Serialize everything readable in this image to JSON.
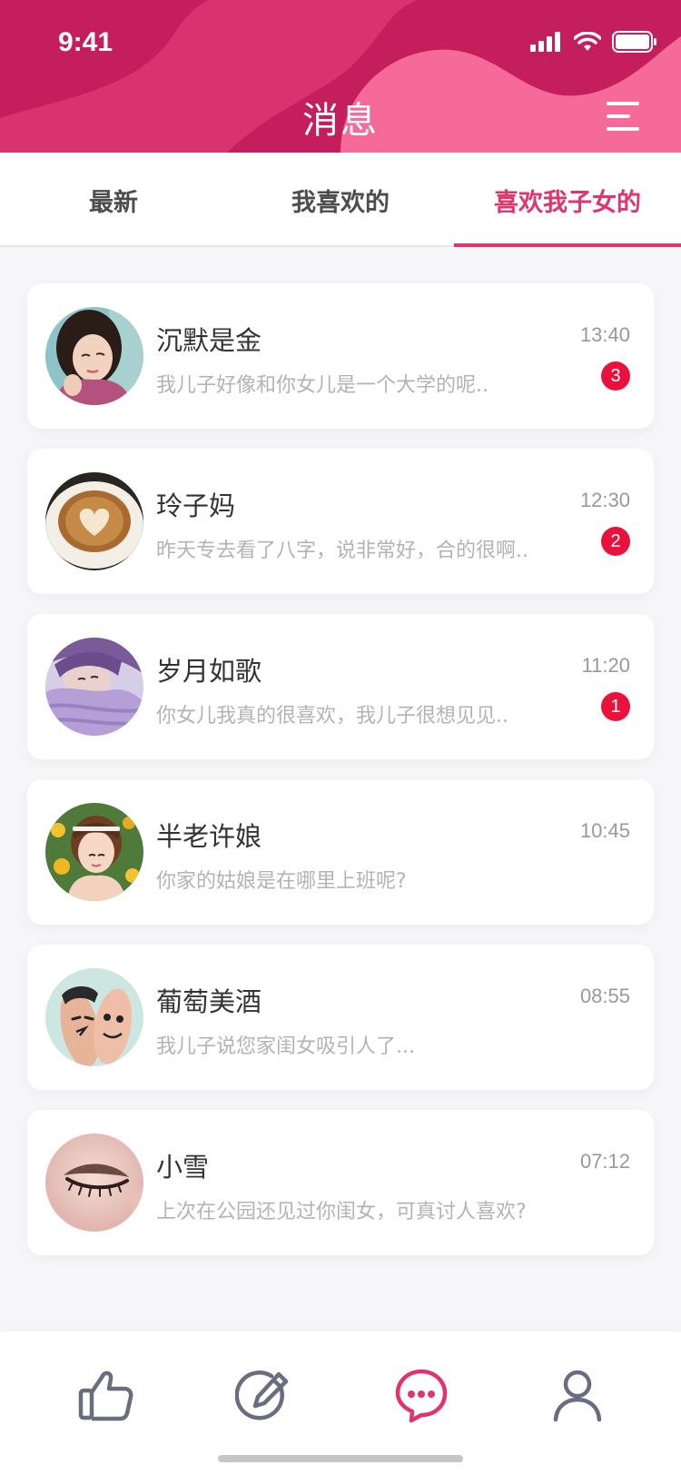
{
  "status_bar": {
    "time": "9:41"
  },
  "header": {
    "title": "消息"
  },
  "tabs": [
    {
      "label": "最新",
      "active": false
    },
    {
      "label": "我喜欢的",
      "active": false
    },
    {
      "label": "喜欢我子女的",
      "active": true
    }
  ],
  "messages": [
    {
      "name": "沉默是金",
      "preview": "我儿子好像和你女儿是一个大学的呢..",
      "time": "13:40",
      "unread": "3",
      "avatar": "woman-pink-sweater-avatar"
    },
    {
      "name": "玲子妈",
      "preview": "昨天专去看了八字，说非常好，合的很啊..",
      "time": "12:30",
      "unread": "2",
      "avatar": "latte-heart-avatar"
    },
    {
      "name": "岁月如歌",
      "preview": "你女儿我真的很喜欢，我儿子很想见见..",
      "time": "11:20",
      "unread": "1",
      "avatar": "woman-purple-scarf-avatar"
    },
    {
      "name": "半老许娘",
      "preview": "你家的姑娘是在哪里上班呢?",
      "time": "10:45",
      "unread": "",
      "avatar": "woman-flowers-avatar"
    },
    {
      "name": "葡萄美酒",
      "preview": "我儿子说您家闺女吸引人了...",
      "time": "08:55",
      "unread": "",
      "avatar": "finger-faces-avatar"
    },
    {
      "name": "小雪",
      "preview": "上次在公园还见过你闺女，可真讨人喜欢?",
      "time": "07:12",
      "unread": "",
      "avatar": "closed-eye-avatar"
    }
  ],
  "bottom_nav": [
    {
      "icon": "thumbs-up-icon",
      "active": false
    },
    {
      "icon": "edit-icon",
      "active": false
    },
    {
      "icon": "chat-bubble-icon",
      "active": true
    },
    {
      "icon": "user-icon",
      "active": false
    }
  ],
  "colors": {
    "brand": "#c41f5c",
    "accent": "#e0346c",
    "badge": "#e8123c",
    "nav_inactive": "#6a6c82"
  }
}
